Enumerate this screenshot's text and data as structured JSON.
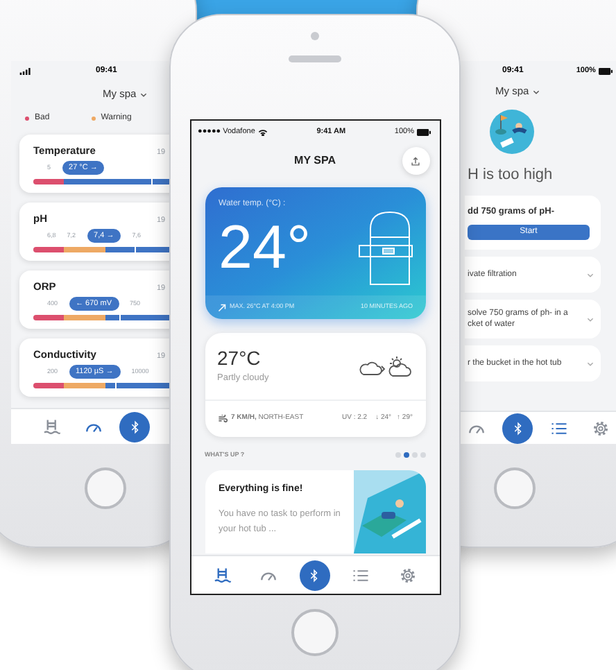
{
  "left_phone": {
    "status": {
      "time": "09:41"
    },
    "header": "My spa",
    "legend": [
      {
        "label": "Bad",
        "color": "#dc4f6e"
      },
      {
        "label": "Warning",
        "color": "#eea964"
      }
    ],
    "metrics": [
      {
        "name": "Temperature",
        "time": "19",
        "kind": "two-zone",
        "ticks_before": [
          "5"
        ],
        "reading": "27 °C →",
        "level": 0.65
      },
      {
        "name": "pH",
        "time": "19",
        "kind": "three-zone",
        "ticks_before": [
          "6,8",
          "7,2"
        ],
        "ticks_after": [
          "7,6"
        ],
        "reading": "7,4 →",
        "level": 0.56
      },
      {
        "name": "ORP",
        "time": "19",
        "kind": "three-zone",
        "ticks_before": [
          "400"
        ],
        "ticks_after": [
          "750"
        ],
        "reading": "← 670 mV",
        "level": 0.48
      },
      {
        "name": "Conductivity",
        "time": "19",
        "kind": "three-zone",
        "ticks_before": [
          "200"
        ],
        "ticks_after": [
          "10000"
        ],
        "reading": "1120 µS →",
        "level": 0.45
      }
    ],
    "nav": [
      {
        "kind": "pool",
        "selected": false
      },
      {
        "kind": "gauge",
        "selected": true
      },
      {
        "kind": "bluetooth",
        "selected": false
      }
    ]
  },
  "main_phone": {
    "status": {
      "carrier": "●●●●● Vodafone",
      "time": "9:41 AM",
      "battery": "100%"
    },
    "title": "MY SPA",
    "water": {
      "label": "Water temp. (°C) :",
      "value": "24°",
      "max": "MAX. 26°C AT 4:00 PM",
      "updated": "10 MINUTES AGO"
    },
    "weather": {
      "temperature": "27°C",
      "condition": "Partly cloudy",
      "wind": "**7 KM/H,** NORTH-EAST",
      "uv": "UV : 2.2",
      "low": "↓ 24°",
      "high": "↑ 29°"
    },
    "section": "WHAT'S UP ?",
    "pager": [
      {
        "selected": false
      },
      {
        "selected": true
      },
      {
        "selected": false
      },
      {
        "selected": false
      }
    ],
    "task": {
      "title": "Everything is fine!",
      "body": "You have no task to perform in your hot tub ..."
    },
    "nav": [
      {
        "kind": "pool",
        "selected": true
      },
      {
        "kind": "gauge",
        "selected": false
      },
      {
        "kind": "bluetooth",
        "selected": false
      },
      {
        "kind": "list",
        "selected": false
      },
      {
        "kind": "settings",
        "selected": false
      }
    ]
  },
  "right_phone": {
    "status": {
      "time": "09:41",
      "battery": "100%"
    },
    "header": "My spa",
    "alert": "H is too high",
    "steps": [
      {
        "kind": "action",
        "text": "dd 750 grams of pH-",
        "button": "Start"
      },
      {
        "kind": "collapsed",
        "text": "ivate filtration"
      },
      {
        "kind": "collapsed",
        "text": "solve 750 grams of ph- in a\ncket of water"
      },
      {
        "kind": "collapsed",
        "text": "r the bucket in the hot tub"
      }
    ],
    "nav": [
      {
        "kind": "gauge",
        "selected": false
      },
      {
        "kind": "bluetooth",
        "selected": false
      },
      {
        "kind": "list",
        "selected": true
      },
      {
        "kind": "settings",
        "selected": false
      }
    ]
  }
}
